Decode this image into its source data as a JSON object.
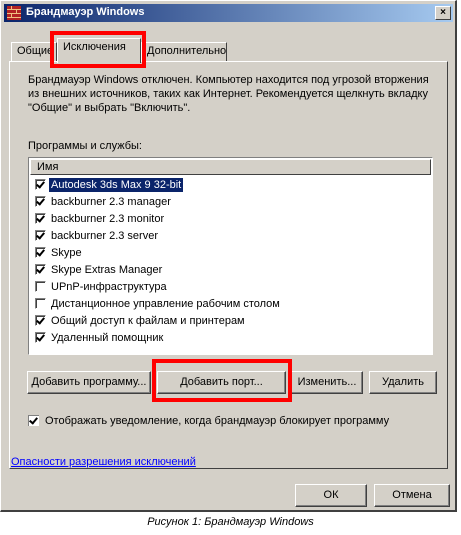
{
  "window": {
    "title": "Брандмауэр Windows",
    "close_glyph": "×"
  },
  "tabs": [
    {
      "label": "Общие"
    },
    {
      "label": "Исключения"
    },
    {
      "label": "Дополнительно"
    }
  ],
  "description": "Брандмауэр Windows отключен. Компьютер находится под угрозой вторжения из внешних источников, таких как Интернет. Рекомендуется щелкнуть вкладку \"Общие\" и выбрать \"Включить\".",
  "programs_label": "Программы и службы:",
  "list": {
    "column_header": "Имя",
    "items": [
      {
        "label": "Autodesk 3ds Max 9 32-bit",
        "checked": true,
        "selected": true
      },
      {
        "label": "backburner 2.3 manager",
        "checked": true
      },
      {
        "label": "backburner 2.3 monitor",
        "checked": true
      },
      {
        "label": "backburner 2.3 server",
        "checked": true
      },
      {
        "label": "Skype",
        "checked": true
      },
      {
        "label": "Skype Extras Manager",
        "checked": true
      },
      {
        "label": "UPnP-инфраструктура",
        "checked": false
      },
      {
        "label": "Дистанционное управление рабочим столом",
        "checked": false
      },
      {
        "label": "Общий доступ к файлам и принтерам",
        "checked": true
      },
      {
        "label": "Удаленный помощник",
        "checked": true
      }
    ]
  },
  "buttons": {
    "add_program": "Добавить программу...",
    "add_port": "Добавить порт...",
    "edit": "Изменить...",
    "delete": "Удалить",
    "ok": "ОК",
    "cancel": "Отмена"
  },
  "notify_checkbox": {
    "label": "Отображать уведомление, когда брандмауэр блокирует программу",
    "checked": true
  },
  "link": "Опасности разрешения исключений",
  "caption": "Рисунок 1: Брандмауэр Windows",
  "colors": {
    "highlight": "#ff0000",
    "selection": "#0a246a",
    "face": "#d4d0c8"
  }
}
